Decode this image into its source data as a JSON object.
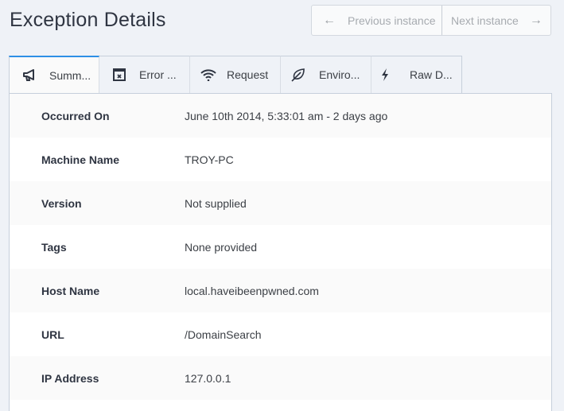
{
  "header": {
    "title": "Exception Details",
    "prev_label": "Previous instance",
    "next_label": "Next instance",
    "prev_icon": "arrow-left-icon",
    "next_icon": "arrow-right-icon"
  },
  "tabs": [
    {
      "label": "Summ...",
      "icon": "megaphone-icon",
      "active": true
    },
    {
      "label": "Error ...",
      "icon": "error-window-icon",
      "active": false
    },
    {
      "label": "Request",
      "icon": "wifi-icon",
      "active": false
    },
    {
      "label": "Enviro...",
      "icon": "leaf-icon",
      "active": false
    },
    {
      "label": "Raw D...",
      "icon": "lightning-icon",
      "active": false
    }
  ],
  "details": [
    {
      "label": "Occurred On",
      "value": "June 10th 2014, 5:33:01 am - 2 days ago"
    },
    {
      "label": "Machine Name",
      "value": "TROY-PC"
    },
    {
      "label": "Version",
      "value": "Not supplied"
    },
    {
      "label": "Tags",
      "value": "None provided"
    },
    {
      "label": "Host Name",
      "value": "local.haveibeenpwned.com"
    },
    {
      "label": "URL",
      "value": "/DomainSearch"
    },
    {
      "label": "IP Address",
      "value": "127.0.0.1"
    }
  ],
  "colors": {
    "accent": "#2d8fe6",
    "background": "#eff2f7"
  }
}
